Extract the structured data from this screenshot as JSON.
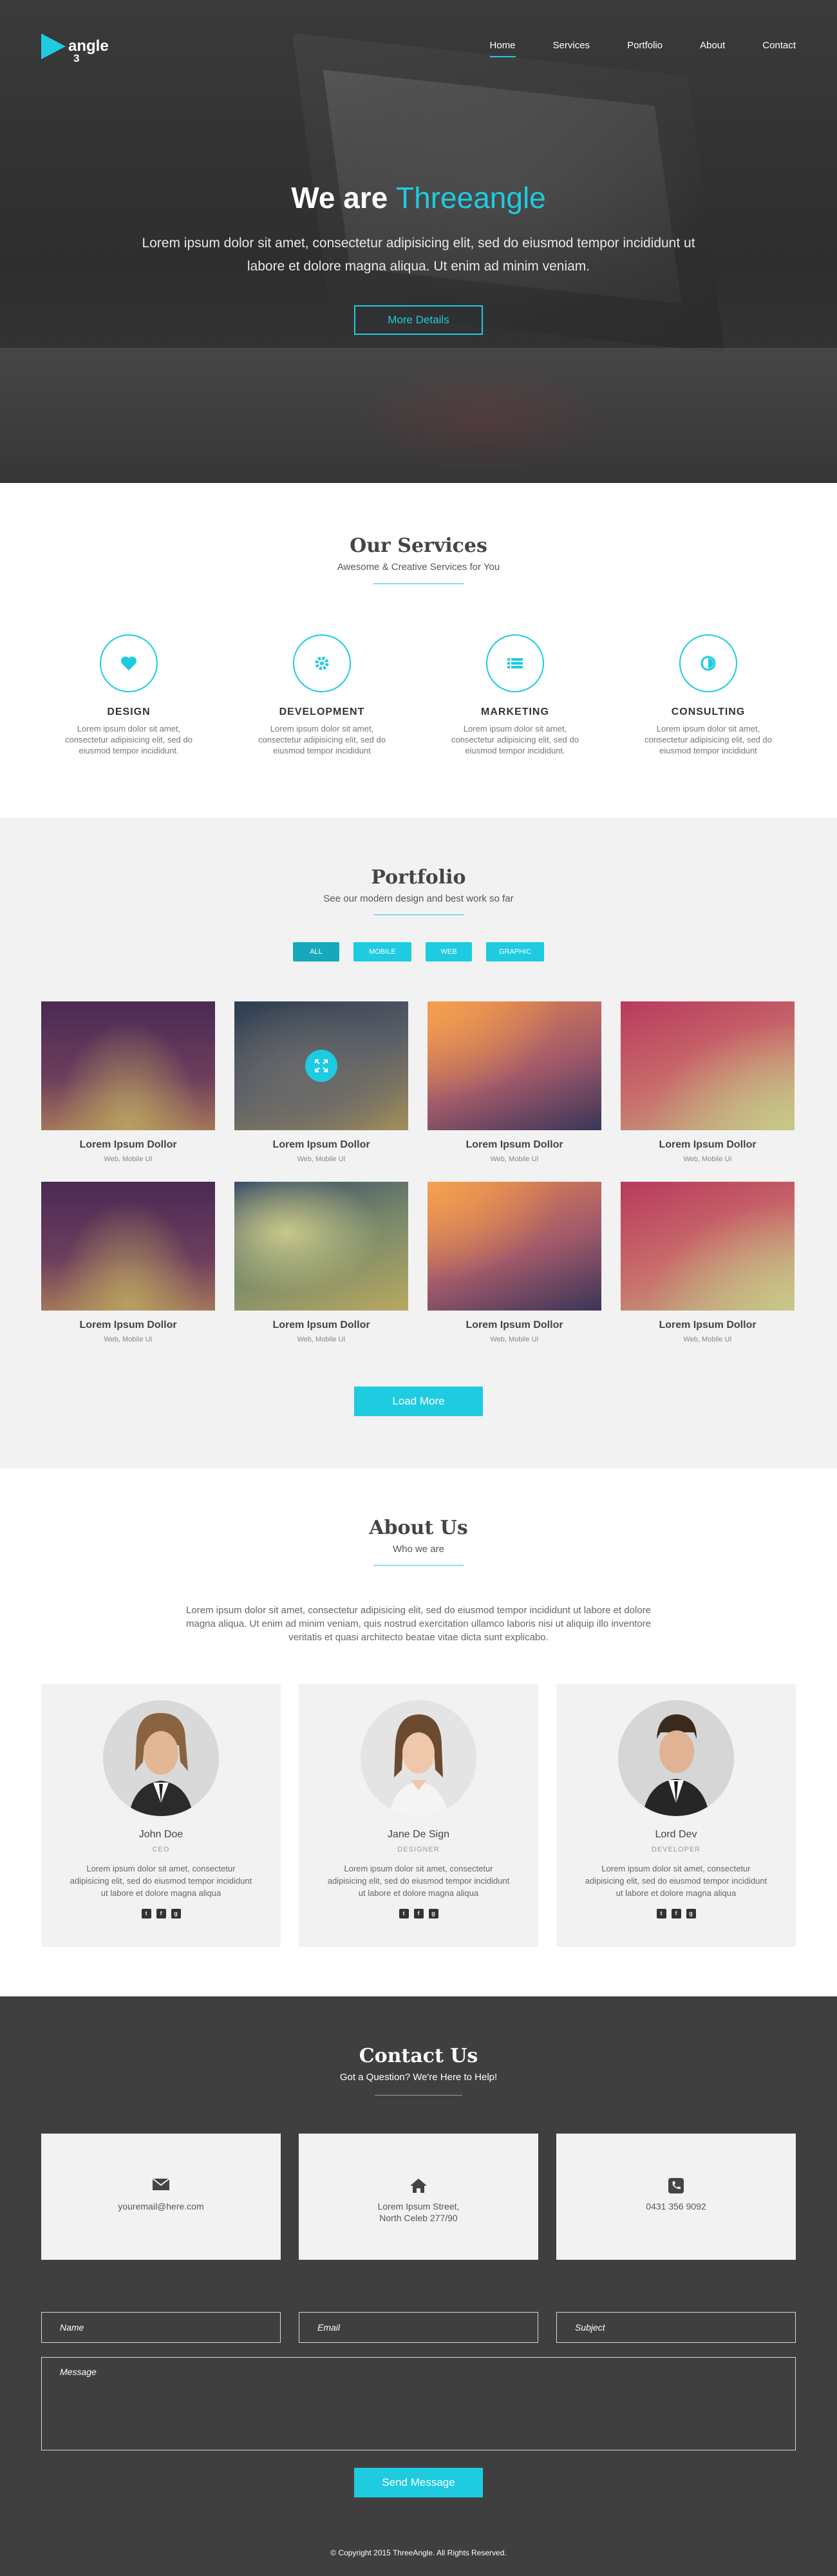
{
  "nav": {
    "logo_num": "3",
    "logo_text": "angle",
    "items": [
      "Home",
      "Services",
      "Portfolio",
      "About",
      "Contact"
    ],
    "active": "Home"
  },
  "hero": {
    "title_prefix": "We are ",
    "title_accent": "Threeangle",
    "text": "Lorem ipsum dolor sit amet, consectetur adipisicing elit, sed do eiusmod tempor incididunt ut labore et dolore magna aliqua. Ut enim ad minim veniam.",
    "button": "More Details"
  },
  "services": {
    "title": "Our Services",
    "subtitle": "Awesome & Creative Services for You",
    "items": [
      {
        "title": "DESIGN",
        "text": "Lorem ipsum dolor sit amet, consectetur adipisicing elit, sed do eiusmod tempor incididunt.",
        "icon": "heart-icon"
      },
      {
        "title": "DEVELOPMENT",
        "text": "Lorem ipsum dolor sit amet, consectetur adipisicing elit, sed do eiusmod tempor incididunt",
        "icon": "gear-icon"
      },
      {
        "title": "MARKETING",
        "text": "Lorem ipsum dolor sit amet, consectetur adipisicing elit, sed do eiusmod tempor incididunt.",
        "icon": "list-icon"
      },
      {
        "title": "CONSULTING",
        "text": "Lorem ipsum dolor sit amet, consectetur adipisicing elit, sed do eiusmod tempor incididunt",
        "icon": "contrast-icon"
      }
    ]
  },
  "portfolio": {
    "title": "Portfolio",
    "subtitle": "See our modern design and best work so far",
    "filters": [
      "ALL",
      "MOBILE",
      "WEB",
      "GRAPHIC"
    ],
    "items": [
      {
        "title": "Lorem Ipsum Dollor",
        "sub": "Web, Mobile UI"
      },
      {
        "title": "Lorem Ipsum Dollor",
        "sub": "Web, Mobile UI"
      },
      {
        "title": "Lorem Ipsum Dollor",
        "sub": "Web, Mobile UI"
      },
      {
        "title": "Lorem Ipsum Dollor",
        "sub": "Web, Mobile UI"
      },
      {
        "title": "Lorem Ipsum Dollor",
        "sub": "Web, Mobile UI"
      },
      {
        "title": "Lorem Ipsum Dollor",
        "sub": "Web, Mobile UI"
      },
      {
        "title": "Lorem Ipsum Dollor",
        "sub": "Web, Mobile UI"
      },
      {
        "title": "Lorem Ipsum Dollor",
        "sub": "Web, Mobile UI"
      }
    ],
    "load_more": "Load More"
  },
  "about": {
    "title": "About Us",
    "subtitle": "Who we are",
    "text": "Lorem ipsum dolor sit amet, consectetur adipisicing elit, sed do eiusmod tempor incididunt ut labore et dolore magna aliqua. Ut enim ad minim veniam, quis nostrud exercitation ullamco laboris nisi ut aliquip illo inventore veritatis et quasi architecto beatae vitae dicta sunt explicabo.",
    "team": [
      {
        "name": "John Doe",
        "role": "CEO",
        "text": "Lorem ipsum dolor sit amet, consectetur adipisicing elit, sed do eiusmod tempor incididunt ut labore et dolore magna aliqua"
      },
      {
        "name": "Jane De Sign",
        "role": "DESIGNER",
        "text": "Lorem ipsum dolor sit amet, consectetur adipisicing elit, sed do eiusmod tempor incididunt ut labore et dolore magna aliqua"
      },
      {
        "name": "Lord Dev",
        "role": "DEVELOPER",
        "text": "Lorem ipsum dolor sit amet, consectetur adipisicing elit, sed do eiusmod tempor incididunt ut labore et dolore magna aliqua"
      }
    ]
  },
  "contact": {
    "title": "Contact Us",
    "subtitle": "Got a Question? We're Here to Help!",
    "email": "youremail@here.com",
    "address_line1": "Lorem Ipsum Street,",
    "address_line2": "North Celeb 277/90",
    "phone": "0431 356 9092",
    "placeholders": {
      "name": "Name",
      "email": "Email",
      "subject": "Subject",
      "message": "Message"
    },
    "send": "Send Message"
  },
  "footer": {
    "copyright": "© Copyright 2015 ThreeAngle. All Rights Reserved."
  },
  "colors": {
    "accent": "#1ecbe1",
    "dark": "#3f3f3f",
    "light": "#f2f2f2"
  }
}
